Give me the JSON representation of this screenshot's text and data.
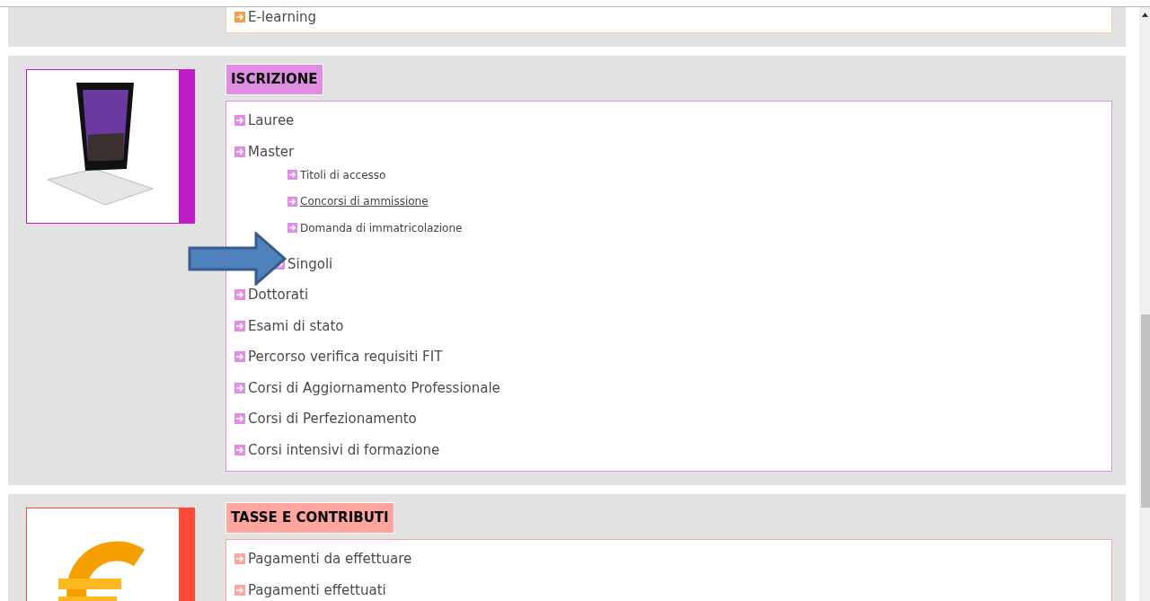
{
  "sections": [
    {
      "kind": "partial",
      "color": "#f5a040",
      "items": [
        {
          "label": "E-learning",
          "underlined": false,
          "kind": "plain"
        }
      ]
    },
    {
      "kind": "tablet",
      "title": "ISCRIZIONE",
      "color": "#c01cc8",
      "items": [
        {
          "label": "Lauree",
          "underlined": false,
          "kind": "plain"
        },
        {
          "label": "Master",
          "underlined": false,
          "kind": "plain",
          "children": [
            {
              "label": "Titoli di accesso",
              "underlined": false
            },
            {
              "label": "Concorsi di ammissione",
              "underlined": true
            },
            {
              "label": "Domanda di immatricolazione",
              "underlined": false
            }
          ]
        },
        {
          "label": "Singoli",
          "underlined": false,
          "kind": "indented"
        },
        {
          "label": "Dottorati",
          "underlined": false,
          "kind": "plain"
        },
        {
          "label": "Esami di stato",
          "underlined": false,
          "kind": "plain"
        },
        {
          "label": "Percorso verifica requisiti FIT",
          "underlined": false,
          "kind": "plain"
        },
        {
          "label": "Corsi di Aggiornamento Professionale",
          "underlined": false,
          "kind": "plain"
        },
        {
          "label": "Corsi di Perfezionamento",
          "underlined": false,
          "kind": "plain"
        },
        {
          "label": "Corsi intensivi di formazione",
          "underlined": false,
          "kind": "plain"
        }
      ]
    },
    {
      "kind": "euro",
      "title": "TASSE E CONTRIBUTI",
      "color": "#ff4a3a",
      "items": [
        {
          "label": "Pagamenti da effettuare",
          "underlined": false,
          "kind": "plain"
        },
        {
          "label": "Pagamenti effettuati",
          "underlined": false,
          "kind": "plain"
        }
      ]
    }
  ]
}
